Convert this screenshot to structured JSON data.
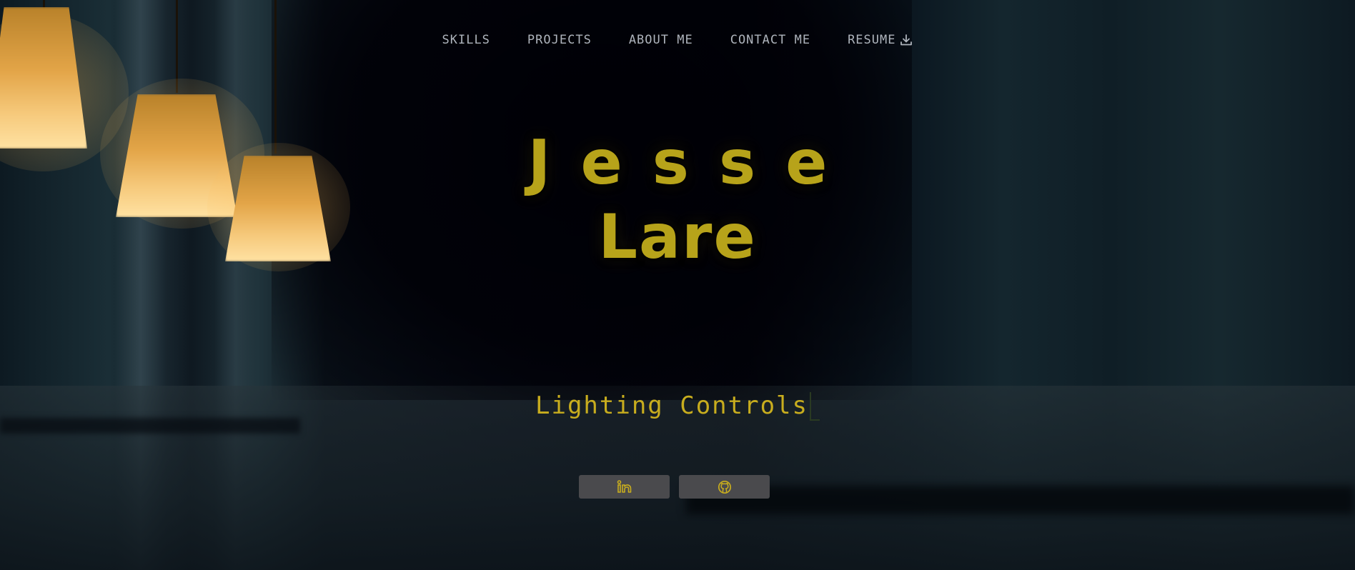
{
  "nav": {
    "items": [
      {
        "label": "SKILLS"
      },
      {
        "label": "PROJECTS"
      },
      {
        "label": "ABOUT ME"
      },
      {
        "label": "CONTACT ME"
      },
      {
        "label": "RESUME",
        "icon": "download-icon"
      }
    ]
  },
  "hero": {
    "first_name": "Jesse",
    "last_name": "Lare",
    "typed_text": "Lighting Controls"
  },
  "social": [
    {
      "icon": "linkedin-icon"
    },
    {
      "icon": "github-icon"
    }
  ],
  "colors": {
    "accent": "#c8ad1e",
    "nav_text": "#aeb4bc",
    "button_bg": "#4a4a4d",
    "background": "#03050c"
  }
}
